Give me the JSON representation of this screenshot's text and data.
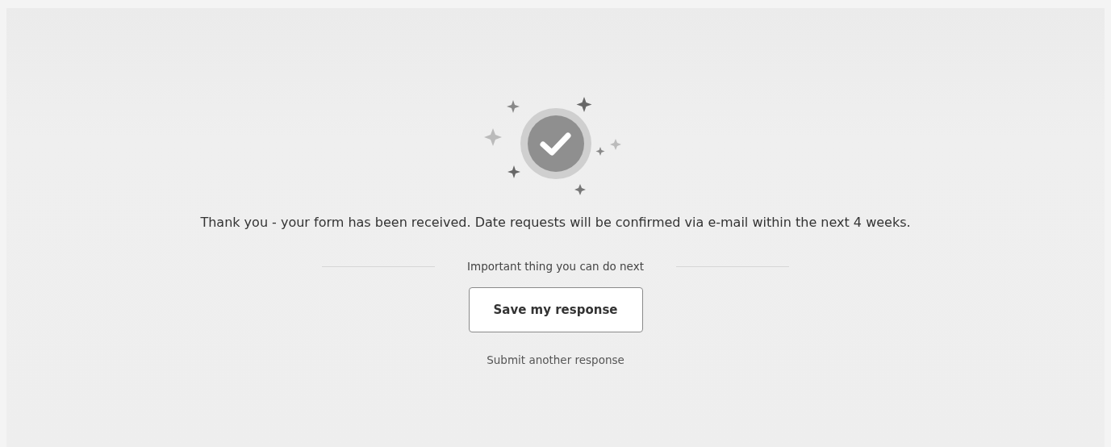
{
  "message": "Thank you - your form has been received. Date requests will be confirmed via e-mail within the next 4 weeks.",
  "next_heading": "Important thing you can do next",
  "buttons": [
    {
      "label": "Save my response",
      "kind": "button"
    },
    {
      "label": "Submit another response",
      "kind": "link"
    }
  ]
}
